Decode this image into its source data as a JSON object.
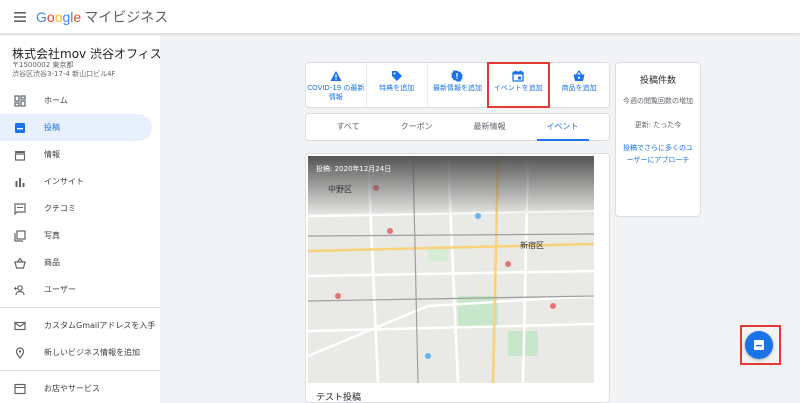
{
  "header": {
    "logo_letters": [
      "G",
      "o",
      "o",
      "g",
      "l",
      "e"
    ],
    "product_name": "マイビジネス",
    "menu_icon": "hamburger-menu-icon"
  },
  "business": {
    "name": "株式会社mov 渋谷オフィス",
    "postal": "〒1500002 東京都",
    "address": "渋谷区渋谷3-17-4 新山口ビル4F"
  },
  "sidebar": {
    "items": [
      {
        "label": "ホーム",
        "icon": "dashboard-icon"
      },
      {
        "label": "投稿",
        "icon": "posts-icon",
        "active": true
      },
      {
        "label": "情報",
        "icon": "store-info-icon"
      },
      {
        "label": "インサイト",
        "icon": "insights-bar-icon"
      },
      {
        "label": "クチコミ",
        "icon": "reviews-icon"
      },
      {
        "label": "写真",
        "icon": "photos-icon"
      },
      {
        "label": "商品",
        "icon": "products-basket-icon"
      },
      {
        "label": "ユーザー",
        "icon": "add-user-icon"
      }
    ],
    "extra_items": [
      {
        "label": "カスタムGmailアドレスを入手",
        "icon": "mail-icon"
      },
      {
        "label": "新しいビジネス情報を追加",
        "icon": "location-pin-icon"
      }
    ],
    "bottom_items": [
      {
        "label": "お店やサービス",
        "icon": "storefront-icon"
      }
    ]
  },
  "post_actions": [
    {
      "label": "COVID-19 の最新情報",
      "icon": "warning-icon"
    },
    {
      "label": "特典を追加",
      "icon": "tag-icon"
    },
    {
      "label": "最新情報を追加",
      "icon": "update-badge-icon"
    },
    {
      "label": "イベントを追加",
      "icon": "calendar-icon",
      "highlighted": true
    },
    {
      "label": "商品を追加",
      "icon": "basket-icon"
    }
  ],
  "tabs": [
    {
      "label": "すべて"
    },
    {
      "label": "クーポン"
    },
    {
      "label": "最新情報"
    },
    {
      "label": "イベント",
      "active": true
    }
  ],
  "post": {
    "date_label": "投稿: 2020年12月24日",
    "title": "テスト投稿",
    "map_labels": [
      "中野区",
      "新宿区"
    ]
  },
  "stats": {
    "title": "投稿件数",
    "description": "今週の閲覧回数の増加",
    "updated": "更新: たった今",
    "link": "投稿でさらに多くのユーザーにアプローチ"
  },
  "fab": {
    "icon": "post-fab-icon"
  },
  "colors": {
    "accent": "#1a73e8",
    "highlight": "#e53935",
    "active_bg": "#e8f0fe"
  }
}
